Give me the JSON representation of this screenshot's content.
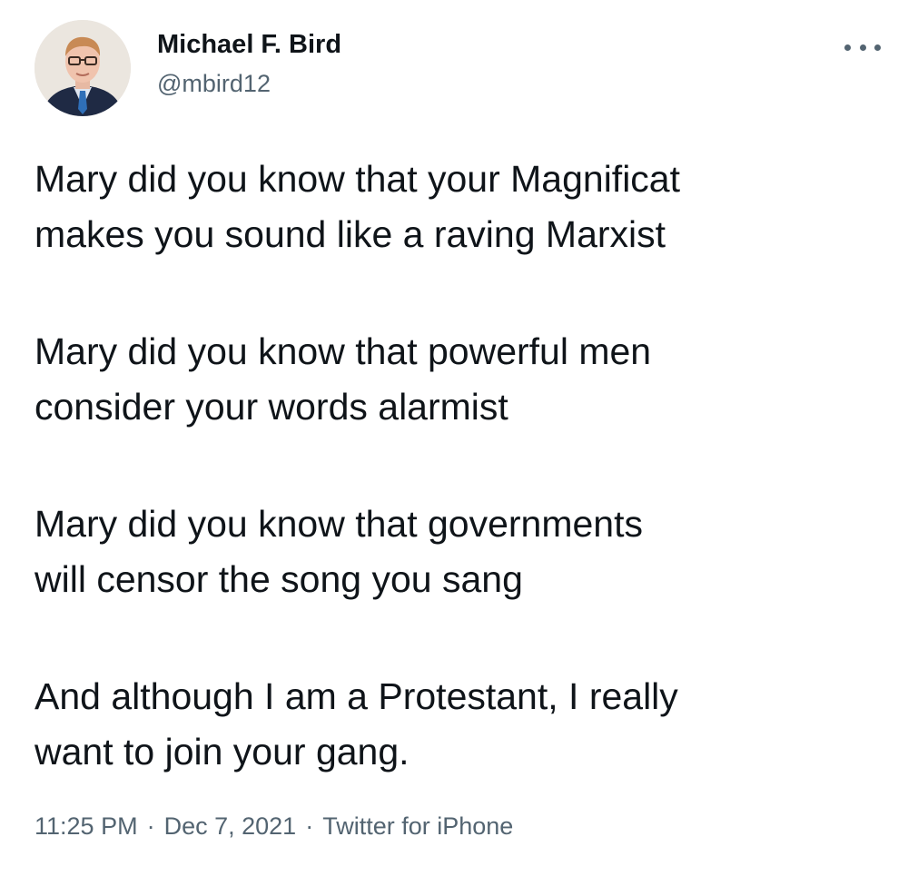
{
  "tweet": {
    "author": {
      "name": "Michael F. Bird",
      "handle": "@mbird12"
    },
    "paragraphs": [
      {
        "line1": "Mary did you know that your Magnificat",
        "line2": "makes you sound like a raving Marxist"
      },
      {
        "line1": "Mary did you know that powerful men",
        "line2": "consider your words alarmist"
      },
      {
        "line1": "Mary did you know that governments",
        "line2": "will censor the song you sang"
      },
      {
        "line1": "And although I am a Protestant, I really",
        "line2": "want to join your gang."
      }
    ],
    "meta": {
      "time": "11:25 PM",
      "separator": "·",
      "date": "Dec 7, 2021",
      "source": "Twitter for iPhone"
    }
  },
  "icons": {
    "more": "more-horizontal-icon"
  },
  "colors": {
    "text_primary": "#0f1419",
    "text_secondary": "#536471",
    "background": "#ffffff"
  }
}
